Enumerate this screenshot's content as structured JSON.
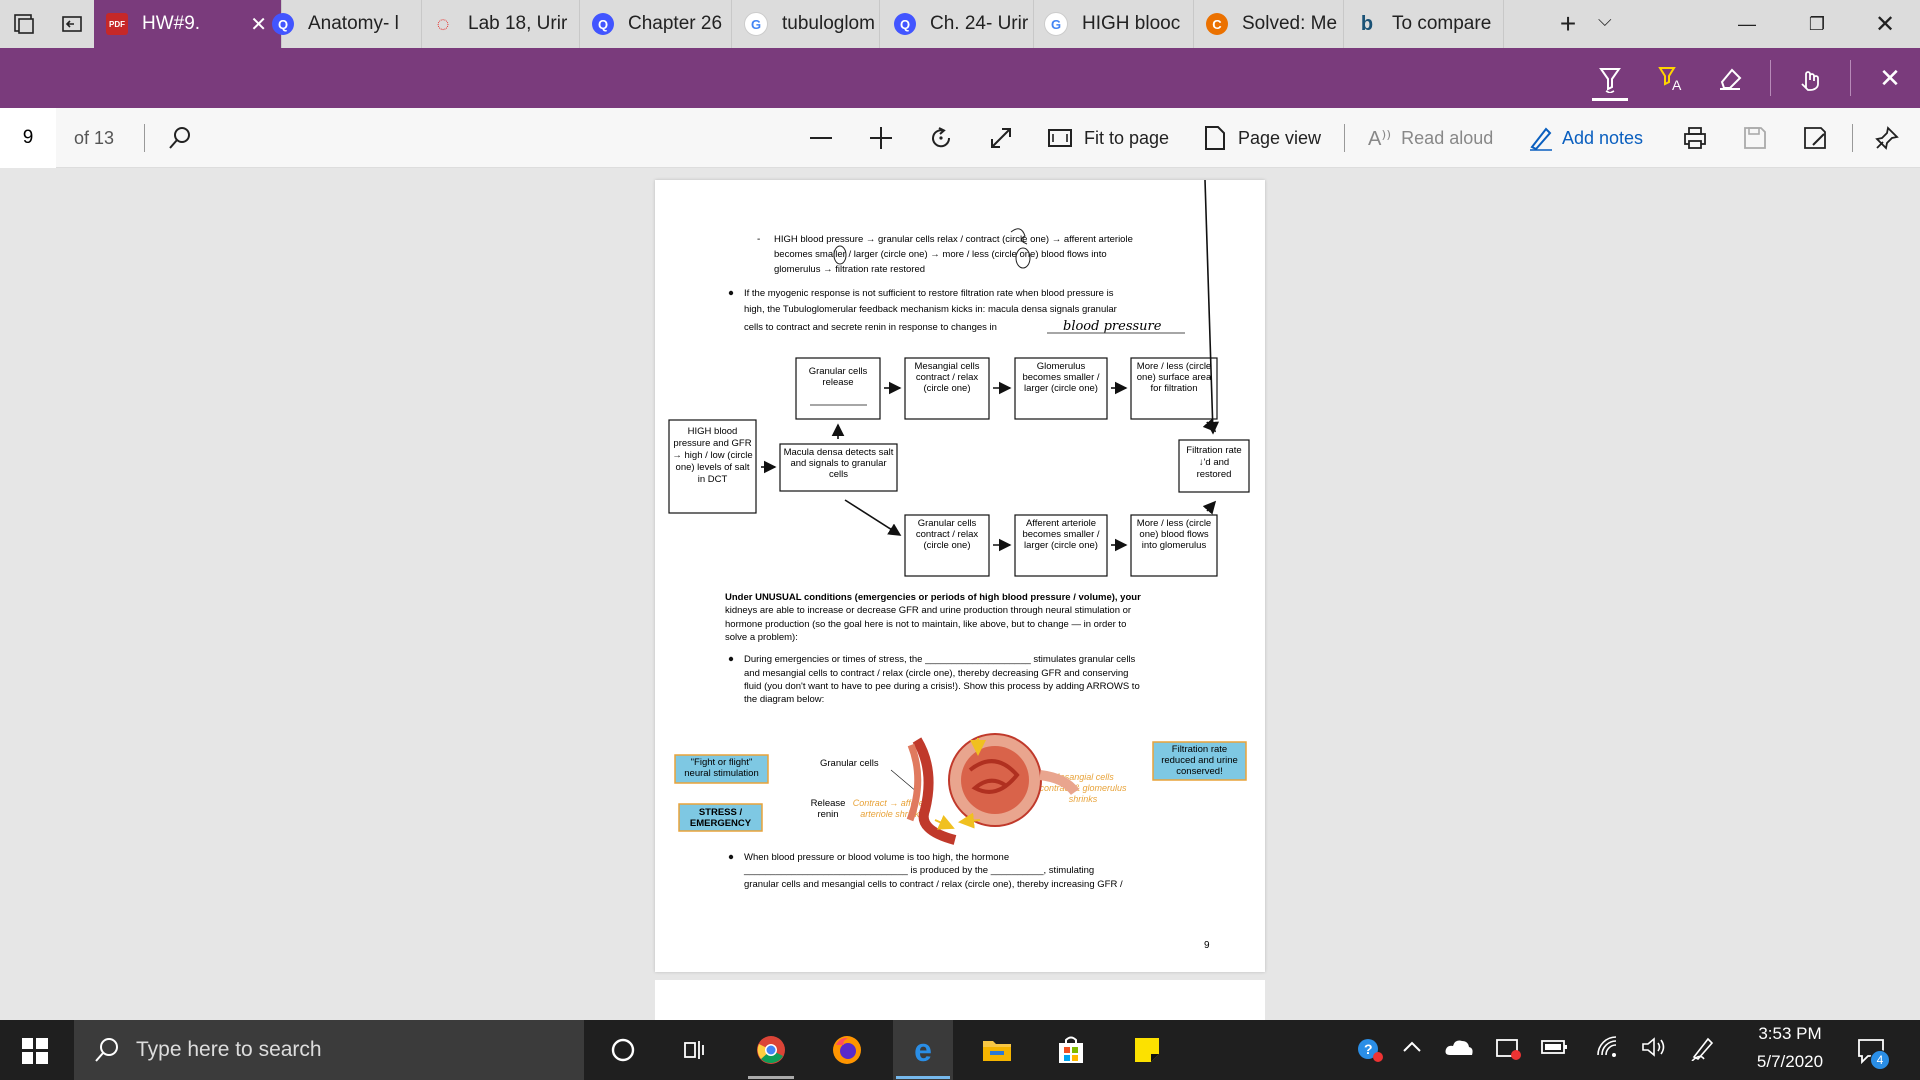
{
  "tabs": [
    {
      "label": "HW#9.",
      "icon": "pdf-icon",
      "active": true
    },
    {
      "label": "Anatomy- l",
      "icon": "quizlet-icon"
    },
    {
      "label": "Lab 18, Urir",
      "icon": "loading-icon"
    },
    {
      "label": "Chapter 26",
      "icon": "quizlet-icon"
    },
    {
      "label": "tubuloglom",
      "icon": "google-icon"
    },
    {
      "label": "Ch. 24- Urir",
      "icon": "quizlet-icon"
    },
    {
      "label": "HIGH blooc",
      "icon": "google-icon"
    },
    {
      "label": "Solved: Me",
      "icon": "chegg-icon"
    },
    {
      "label": "To compare",
      "icon": "bing-icon"
    }
  ],
  "toolbar": {
    "page_number": "9",
    "page_total": "of 13",
    "fit_to_page": "Fit to page",
    "page_view": "Page view",
    "read_aloud": "Read aloud",
    "add_notes": "Add notes"
  },
  "doc": {
    "bullet1_l1": "HIGH blood pressure → granular cells relax / contract (circle one) → afferent arteriole",
    "bullet1_l2": "becomes smaller / larger (circle one) → more / less (circle one) blood flows into",
    "bullet1_l3": "glomerulus → filtration rate restored",
    "bullet2_l1": "If the myogenic response is not sufficient to restore filtration rate when blood pressure is",
    "bullet2_l2": "high, the Tubuloglomerular feedback mechanism kicks in: macula densa signals granular",
    "bullet2_l3": "cells to contract and secrete renin in response to changes in",
    "handwritten_answer": "blood pressure",
    "box_granular_release": "Granular cells release",
    "box_mesangial": "Mesangial cells contract / relax (circle one)",
    "box_glomerulus": "Glomerulus becomes smaller / larger (circle one)",
    "box_more_surface": "More / less (circle one) surface area for filtration",
    "box_high_bp": "HIGH blood pressure and GFR → high / low (circle one) levels of salt in DCT",
    "box_macula": "Macula densa detects salt and signals to granular cells",
    "box_filtration": "Filtration rate ↓'d and restored",
    "box_granular_contract": "Granular cells contract / relax (circle one)",
    "box_afferent": "Afferent arteriole becomes smaller / larger (circle one)",
    "box_more_blood": "More / less (circle one) blood flows into glomerulus",
    "unusual_l1": "Under UNUSUAL conditions (emergencies or periods of high blood pressure / volume), your",
    "unusual_l2": "kidneys are able to increase or decrease GFR and urine production through neural stimulation or",
    "unusual_l3": "hormone production (so the goal here is not to maintain, like above, but to change — in order to",
    "unusual_l4": "solve a problem):",
    "stress_l1": "During emergencies or times of stress, the ____________________ stimulates granular cells",
    "stress_l2": "and mesangial cells to contract / relax (circle one), thereby decreasing GFR and conserving",
    "stress_l3": "fluid (you don't want to have to pee during a crisis!). Show this process by adding ARROWS to",
    "stress_l4": "the diagram below:",
    "fight_flight": "\"Fight or flight\" neural stimulation",
    "stress_emergency": "STRESS / EMERGENCY",
    "granular_cells_label": "Granular cells",
    "release_renin": "Release renin",
    "contract_afferent": "Contract → afferent arteriole shrinks",
    "mesangial_label": "Mesangial cells contract & glomerulus shrinks",
    "filtration_reduced": "Filtration rate reduced and urine conserved!",
    "hormone_l1": "When blood pressure or blood volume is too high, the hormone",
    "hormone_l2": "_______________________________ is produced by the __________, stimulating",
    "hormone_l3": "granular cells and mesangial cells to contract / relax (circle one), thereby increasing GFR /",
    "page_num": "9"
  },
  "taskbar": {
    "search_placeholder": "Type here to search",
    "time": "3:53 PM",
    "date": "5/7/2020",
    "notification_count": "4"
  },
  "colors": {
    "accent": "#7a3b7c",
    "link": "#0a5fbf",
    "label_blue": "#7ec8e3",
    "orange": "#e8a33a"
  }
}
